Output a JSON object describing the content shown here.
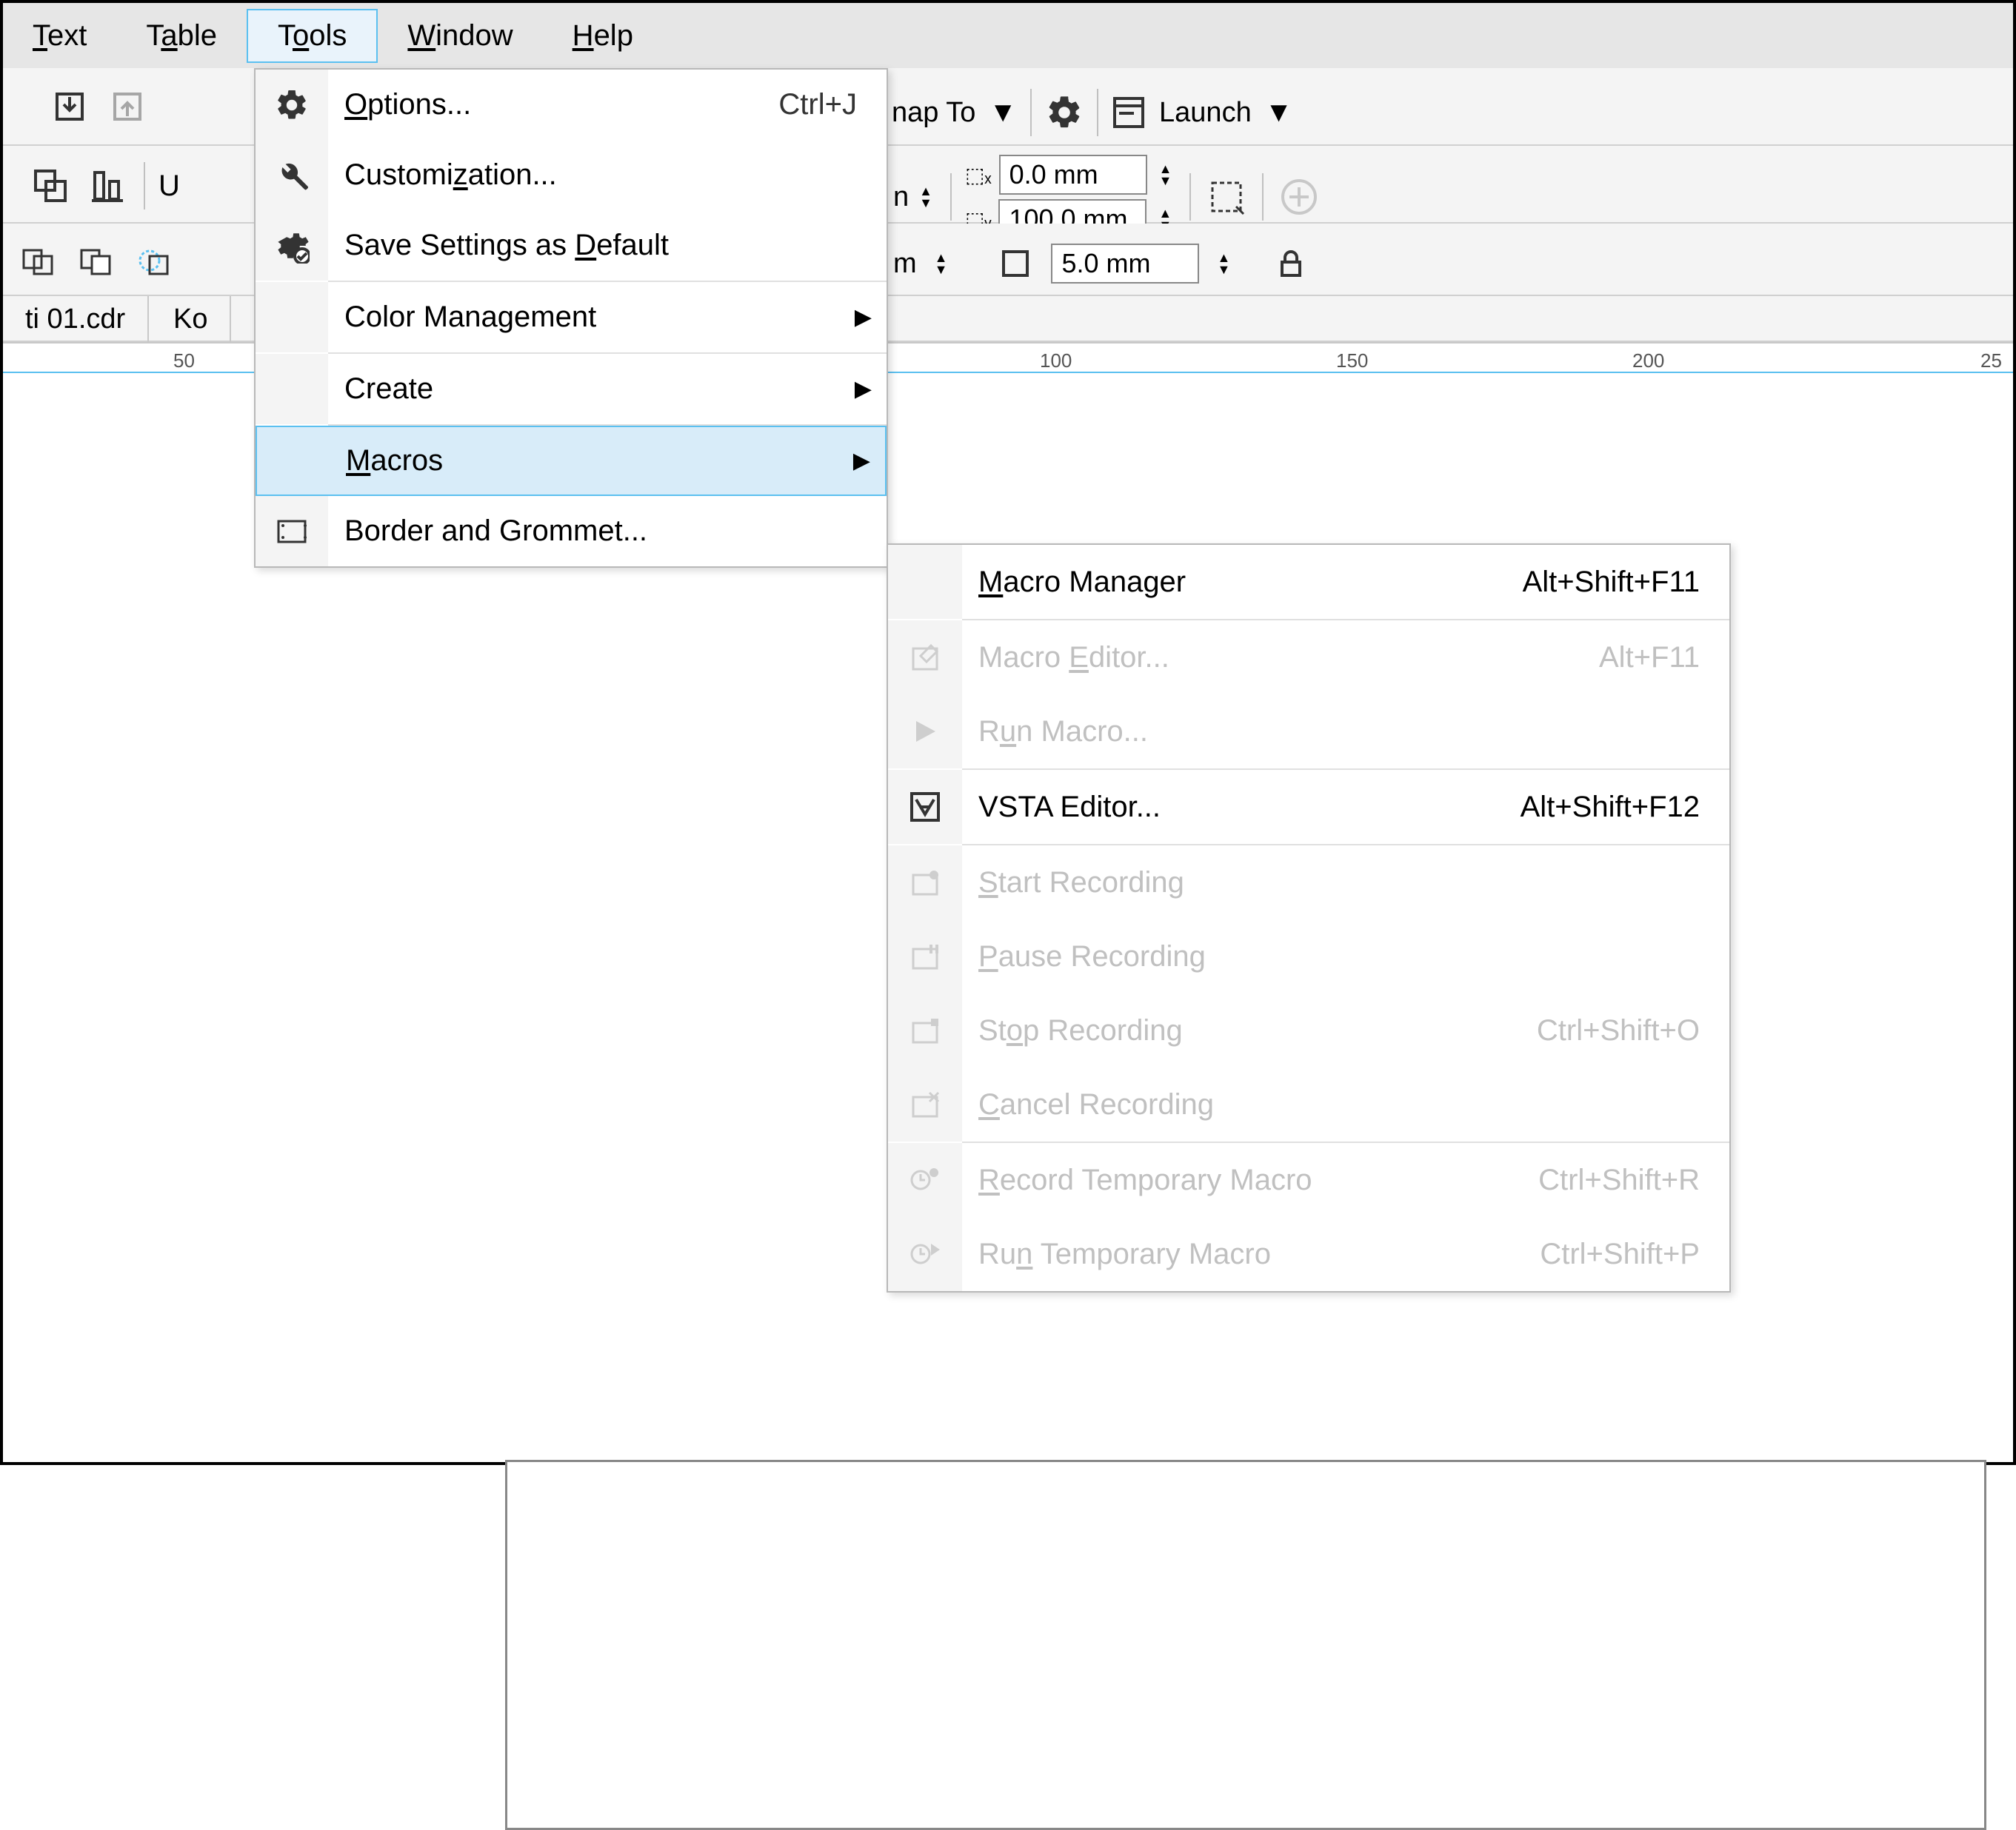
{
  "menubar": {
    "items": [
      "Text",
      "Table",
      "Tools",
      "Window",
      "Help"
    ],
    "active_index": 2
  },
  "toolbar1": {
    "snap_to": "nap To",
    "launch": "Launch"
  },
  "toolbar2": {
    "u_label": "U",
    "n_label": "n",
    "x_val": "0.0 mm",
    "y_val": "100.0 mm"
  },
  "toolbar3": {
    "m_label": "m",
    "val2": "5.0 mm"
  },
  "tabs": {
    "file1": "ti 01.cdr",
    "file2": "Ko"
  },
  "ruler": {
    "t50": "50",
    "t100": "100",
    "t150": "150",
    "t200": "200",
    "t25": "25"
  },
  "tools_menu": {
    "options": {
      "label": "Options...",
      "shortcut": "Ctrl+J"
    },
    "customization": "Customization...",
    "save_default": "Save Settings as Default",
    "color_mgmt": "Color Management",
    "create": "Create",
    "macros": "Macros",
    "border_grommet": "Border and Grommet..."
  },
  "macros_submenu": {
    "macro_manager": {
      "label": "Macro Manager",
      "shortcut": "Alt+Shift+F11"
    },
    "macro_editor": {
      "label": "Macro Editor...",
      "shortcut": "Alt+F11"
    },
    "run_macro": "Run Macro...",
    "vsta_editor": {
      "label": "VSTA Editor...",
      "shortcut": "Alt+Shift+F12"
    },
    "start_rec": "Start Recording",
    "pause_rec": "Pause Recording",
    "stop_rec": {
      "label": "Stop Recording",
      "shortcut": "Ctrl+Shift+O"
    },
    "cancel_rec": "Cancel Recording",
    "rec_temp": {
      "label": "Record Temporary Macro",
      "shortcut": "Ctrl+Shift+R"
    },
    "run_temp": {
      "label": "Run Temporary Macro",
      "shortcut": "Ctrl+Shift+P"
    }
  }
}
